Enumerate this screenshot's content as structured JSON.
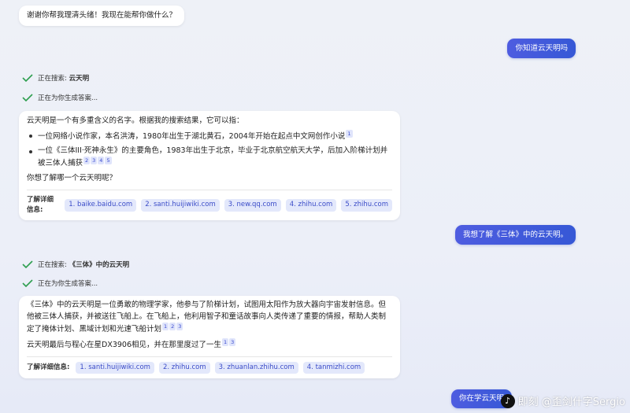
{
  "messages": {
    "greeting": "谢谢你帮我理清头绪！我现在能帮你做什么？",
    "user_q1": "你知道云天明吗",
    "status1_prefix": "正在搜索: ",
    "status1_term": "云天明",
    "status2": "正在为你生成答案...",
    "answer1_intro": "云天明是一个有多重含义的名字。根据我的搜索结果，它可以指：",
    "answer1_point1": "一位网络小说作家，本名洪涛，1980年出生于湖北黄石，2004年开始在起点中文网创作小说",
    "answer1_point1_cites": [
      "1"
    ],
    "answer1_point2": "一位《三体III·死神永生》的主要角色，1983年出生于北京，毕业于北京航空航天大学，后加入阶梯计划并被三体人捕获",
    "answer1_point2_cites": [
      "2",
      "3",
      "4",
      "5"
    ],
    "answer1_question": "你想了解哪一个云天明呢？",
    "learn_more_label": "了解详细信息:",
    "answer1_sources": [
      "1. baike.baidu.com",
      "2. santi.huijiwiki.com",
      "3. new.qq.com",
      "4. zhihu.com",
      "5. zhihu.com"
    ],
    "user_q2": "我想了解《三体》中的云天明。",
    "status3_prefix": "正在搜索: ",
    "status3_term": "《三体》中的云天明",
    "status4": "正在为你生成答案...",
    "answer2_p1": "《三体》中的云天明是一位勇敢的物理学家，他参与了阶梯计划，试图用太阳作为放大器向宇宙发射信息。但他被三体人捕获，并被送往飞船上。在飞船上，他利用智子和童话故事向人类传递了重要的情报，帮助人类制定了掩体计划、黑域计划和光速飞船计划",
    "answer2_p1_cites": [
      "1",
      "2",
      "3"
    ],
    "answer2_p2": "云天明最后与程心在星DX3906相见，并在那里度过了一生",
    "answer2_p2_cites": [
      "1",
      "3"
    ],
    "answer2_sources": [
      "1. santi.huijiwiki.com",
      "2. zhihu.com",
      "3. zhuanlan.zhihu.com",
      "4. tanmizhi.com"
    ],
    "user_q3_partial": "你在学云天明"
  },
  "watermark": {
    "logo_glyph": "♪",
    "text": "即刻 @歪剑什字Sergio"
  },
  "colors": {
    "accent": "#3658d6",
    "check": "#2e9e4f",
    "citation_bg": "#dfe4fb"
  }
}
